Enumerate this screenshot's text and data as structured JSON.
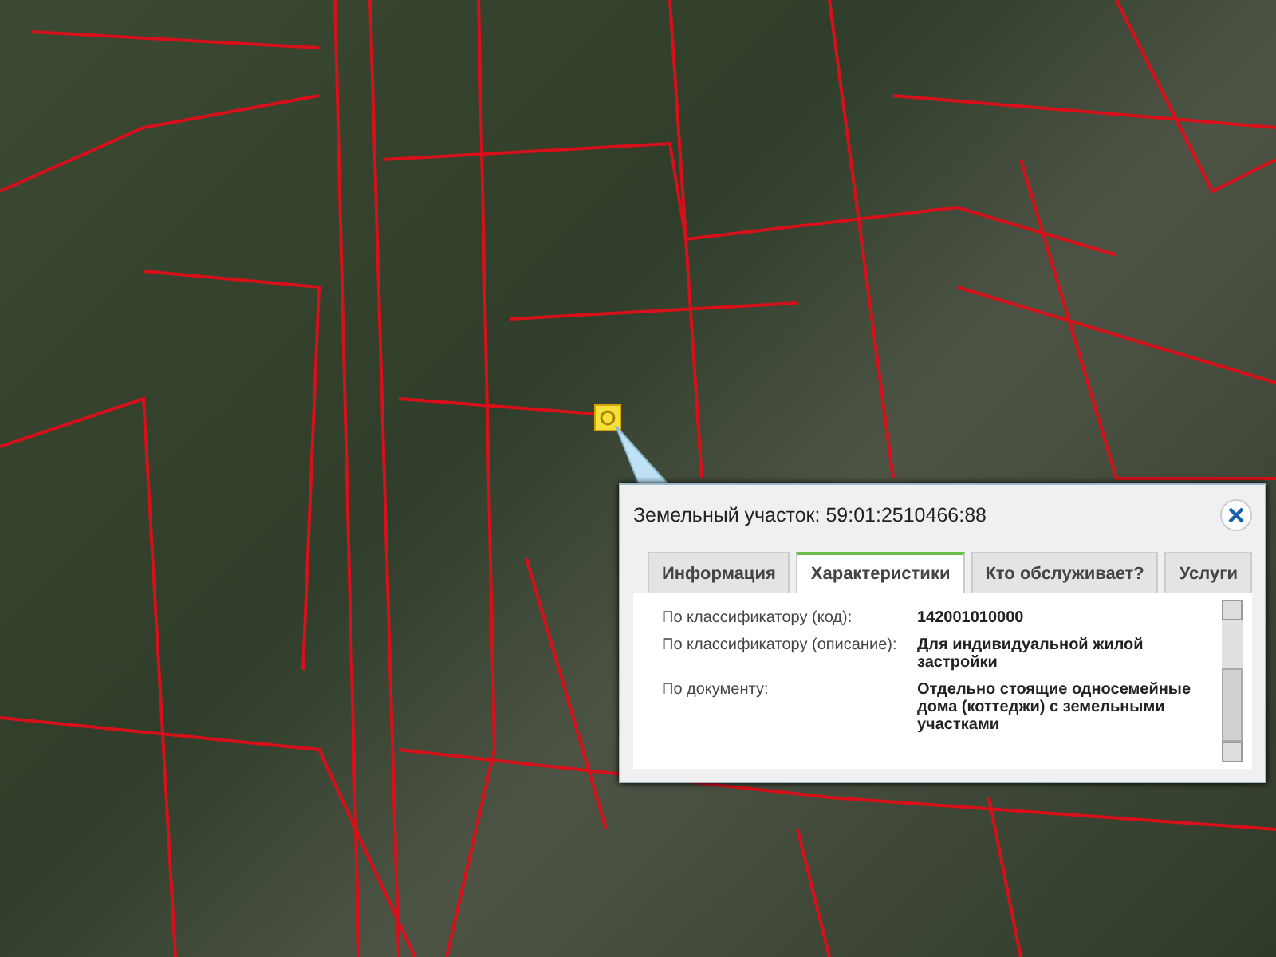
{
  "popup": {
    "title": "Земельный участок: 59:01:2510466:88",
    "tabs": [
      {
        "label": "Информация",
        "selected": false
      },
      {
        "label": "Характеристики",
        "selected": true
      },
      {
        "label": "Кто обслуживает?",
        "selected": false
      },
      {
        "label": "Услуги",
        "selected": false
      }
    ],
    "rows": [
      {
        "label": "По классификатору (код):",
        "value": "142001010000"
      },
      {
        "label": "По классификатору (описание):",
        "value": "Для индивидуальной жилой застройки"
      },
      {
        "label": "По документу:",
        "value": "Отдельно стоящие односемейные дома (коттеджи) с земельными участками"
      }
    ]
  }
}
